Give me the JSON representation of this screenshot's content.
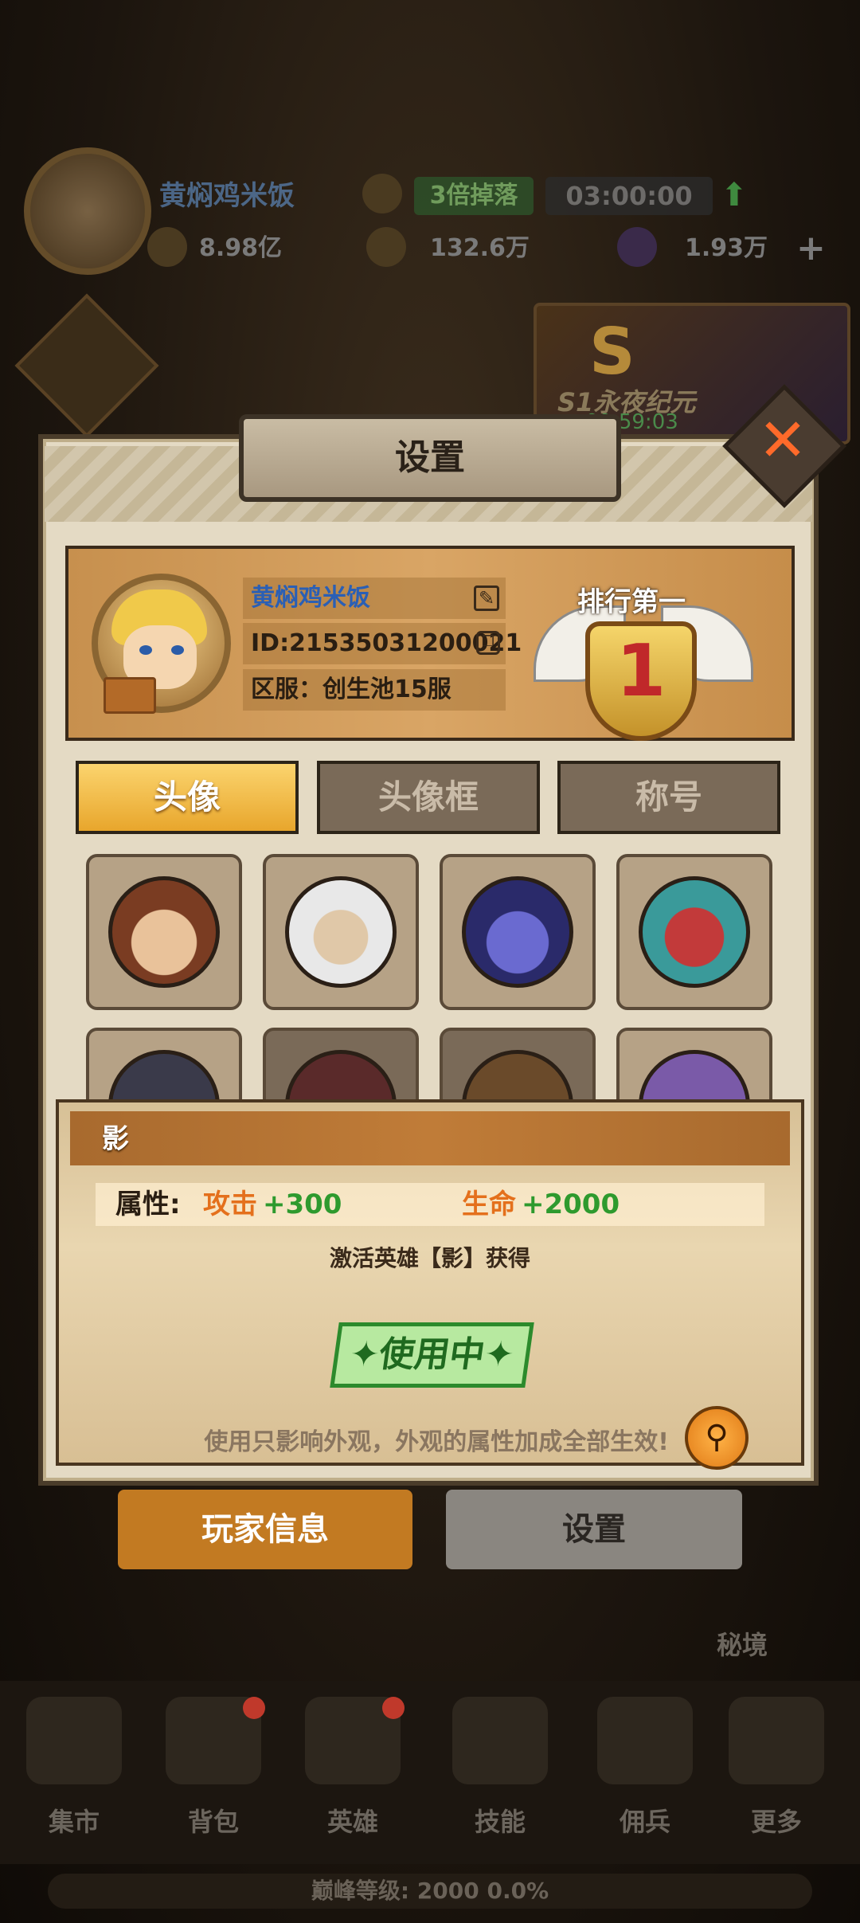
{
  "hud": {
    "player_name": "黄焖鸡米饭",
    "drop_tag": "3倍掉落",
    "timer": "03:00:00",
    "power": "8.98亿",
    "gold": "132.6万",
    "gems": "1.93万",
    "event_name": "S1永夜纪元",
    "event_timer": "00:59:03"
  },
  "modal": {
    "title": "设置",
    "profile": {
      "name": "黄焖鸡米饭",
      "id": "ID:21535031200021",
      "server": "区服：创生池15服",
      "rank_title": "排行第一",
      "rank_number": "1"
    },
    "tabs": [
      {
        "label": "头像",
        "active": true
      },
      {
        "label": "头像框",
        "active": false
      },
      {
        "label": "称号",
        "active": false
      }
    ],
    "avatars": [
      {
        "icon": "hero-brown-hair"
      },
      {
        "icon": "hero-white-beard"
      },
      {
        "icon": "hero-blue-elf"
      },
      {
        "icon": "hero-red-masked"
      },
      {
        "icon": "hero-dark-helmet"
      },
      {
        "icon": "hero-red-hair"
      },
      {
        "icon": "hero-brown-short"
      },
      {
        "icon": "hero-purple-hair"
      }
    ],
    "detail": {
      "name": "影",
      "attr_label": "属性:",
      "attack_label": "攻击",
      "attack_value": "+300",
      "hp_label": "生命",
      "hp_value": "+2000",
      "source": "激活英雄【影】获得",
      "button": "✦使用中✦",
      "note": "使用只影响外观，外观的属性加成全部生效!"
    }
  },
  "buttons": {
    "player_info": "玩家信息",
    "settings": "设置"
  },
  "mijing": "秘境",
  "nav": [
    {
      "label": "集市",
      "dot": false
    },
    {
      "label": "背包",
      "dot": true
    },
    {
      "label": "英雄",
      "dot": true
    },
    {
      "label": "技能",
      "dot": false
    },
    {
      "label": "佣兵",
      "dot": false
    },
    {
      "label": "更多",
      "dot": false
    }
  ],
  "peak_level": "巅峰等级: 2000 0.0%"
}
